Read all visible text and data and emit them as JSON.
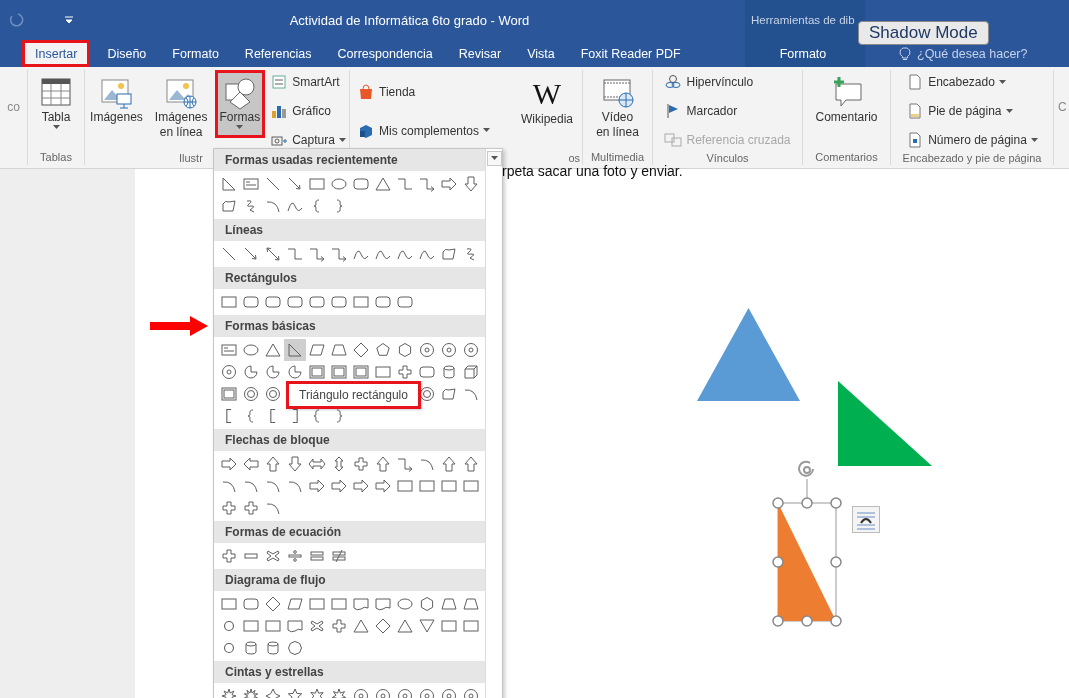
{
  "title_bar": {
    "title": "Actividad de Informática 6to grado - Word",
    "context_label": "Herramientas de dib",
    "overlay_badge": "Shadow Mode"
  },
  "tabs": [
    {
      "label": "Insertar",
      "kind": "standard",
      "selected": true,
      "annotated": true
    },
    {
      "label": "Diseño",
      "kind": "standard",
      "selected": false,
      "annotated": false
    },
    {
      "label": "Formato",
      "kind": "standard",
      "selected": false,
      "annotated": false
    },
    {
      "label": "Referencias",
      "kind": "standard",
      "selected": false,
      "annotated": false
    },
    {
      "label": "Correspondencia",
      "kind": "standard",
      "selected": false,
      "annotated": false
    },
    {
      "label": "Revisar",
      "kind": "standard",
      "selected": false,
      "annotated": false
    },
    {
      "label": "Vista",
      "kind": "standard",
      "selected": false,
      "annotated": false
    },
    {
      "label": "Foxit Reader PDF",
      "kind": "standard",
      "selected": false,
      "annotated": false
    },
    {
      "label": "Formato",
      "kind": "contextual",
      "selected": false,
      "annotated": false
    }
  ],
  "tell_me": {
    "placeholder": "¿Qué desea hacer?"
  },
  "ribbon": {
    "groups": [
      {
        "items": [
          {
            "kind": "cut",
            "label": "co"
          }
        ]
      },
      {
        "label": "Tablas",
        "items": [
          {
            "kind": "large",
            "label": "Tabla",
            "dropdown": true
          }
        ]
      },
      {
        "label": "Ilustr",
        "items": [
          {
            "kind": "large",
            "label": "Imágenes"
          },
          {
            "kind": "large",
            "label": "Imágenes en línea"
          },
          {
            "kind": "large",
            "label": "Formas",
            "dropdown": true,
            "pressed": true,
            "annotated": true
          },
          {
            "kind": "small",
            "label": "SmartArt"
          },
          {
            "kind": "small",
            "label": "Gráfico"
          },
          {
            "kind": "small",
            "label": "Captura",
            "dropdown": true
          }
        ]
      },
      {
        "label": "os",
        "items": [
          {
            "kind": "small",
            "label": "Tienda"
          },
          {
            "kind": "small",
            "label": "Mis complementos",
            "dropdown": true
          },
          {
            "kind": "large",
            "label": "Wikipedia",
            "glyph": "W"
          }
        ]
      },
      {
        "label": "Multimedia",
        "items": [
          {
            "kind": "large",
            "label": "Vídeo en línea"
          }
        ]
      },
      {
        "label": "Vínculos",
        "items": [
          {
            "kind": "small",
            "label": "Hipervínculo"
          },
          {
            "kind": "small",
            "label": "Marcador"
          },
          {
            "kind": "small",
            "label": "Referencia cruzada",
            "disabled": true
          }
        ]
      },
      {
        "label": "Comentarios",
        "items": [
          {
            "kind": "large",
            "label": "Comentario"
          }
        ]
      },
      {
        "label": "Encabezado y pie de página",
        "items": [
          {
            "kind": "small",
            "label": "Encabezado",
            "dropdown": true
          },
          {
            "kind": "small",
            "label": "Pie de página",
            "dropdown": true
          },
          {
            "kind": "small",
            "label": "Número de página",
            "dropdown": true
          }
        ]
      },
      {
        "items": [
          {
            "kind": "cut",
            "label": "C"
          }
        ]
      }
    ]
  },
  "shapes_menu": {
    "sections": [
      {
        "title": "Formas usadas recientemente"
      },
      {
        "title": "Líneas"
      },
      {
        "title": "Rectángulos"
      },
      {
        "title": "Formas básicas",
        "arrow_marker": true,
        "tooltip": {
          "text": "Triángulo rectángulo",
          "annotated": true
        }
      },
      {
        "title": "Flechas de bloque"
      },
      {
        "title": "Formas de ecuación"
      },
      {
        "title": "Diagrama de flujo"
      },
      {
        "title": "Cintas y estrellas"
      }
    ]
  },
  "document": {
    "text_line": "rpeta sacar una foto y enviar.",
    "shapes": [
      {
        "kind": "isosceles-triangle",
        "color": "#5b9bd5",
        "selected": false
      },
      {
        "kind": "right-triangle",
        "color": "#00b050",
        "selected": false
      },
      {
        "kind": "right-triangle",
        "color": "#ed7d31",
        "selected": true
      }
    ]
  }
}
